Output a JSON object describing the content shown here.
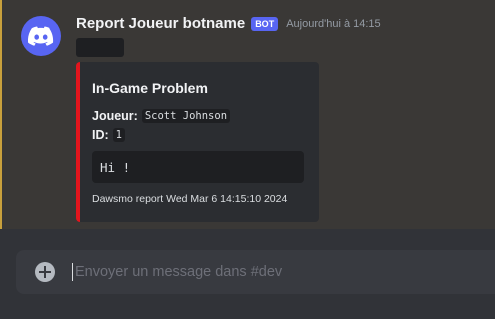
{
  "message": {
    "username": "Report Joueur botname",
    "bot_tag": "BOT",
    "timestamp": "Aujourd'hui à 14:15",
    "avatar_icon": "discord-logo-icon",
    "highlight_color": "#c8a03c",
    "embed": {
      "accent_color": "#e3151d",
      "title": "In-Game Problem",
      "fields": [
        {
          "key": "Joueur:",
          "value": "Scott Johnson"
        },
        {
          "key": "ID:",
          "value": "1"
        }
      ],
      "code_block": "Hi !",
      "footer": "Dawsmo report Wed Mar  6 14:15:10 2024"
    }
  },
  "composer": {
    "placeholder": "Envoyer un message dans #dev",
    "value": "",
    "add_icon": "plus-circle-icon"
  }
}
